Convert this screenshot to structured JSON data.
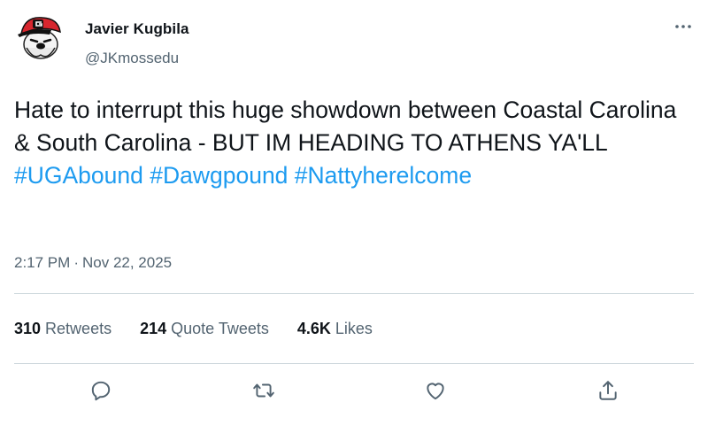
{
  "author": {
    "name": "Javier Kugbila",
    "handle": "@JKmossedu",
    "avatar_icon": "bulldog-mascot-avatar"
  },
  "tweet": {
    "text_lines": "Hate to interrupt this huge showdown between Coastal Carolina & South Carolina - BUT IM HEADING TO ATHENS YA'LL",
    "hashtags": [
      "#UGAbound",
      "#Dawgpound",
      "#Nattyherelcome"
    ],
    "time": "2:17 PM",
    "separator": "·",
    "date": "Nov 22, 2025"
  },
  "stats": {
    "retweets": {
      "count": "310",
      "label": "Retweets"
    },
    "quote_tweets": {
      "count": "214",
      "label": "Quote Tweets"
    },
    "likes": {
      "count": "4.6K",
      "label": "Likes"
    }
  },
  "actions": [
    "reply-icon",
    "retweet-icon",
    "like-icon",
    "share-icon"
  ],
  "colors": {
    "link": "#1d9bf0",
    "secondary_text": "#536471",
    "primary_text": "#0f1419",
    "divider": "#cfd9de"
  }
}
